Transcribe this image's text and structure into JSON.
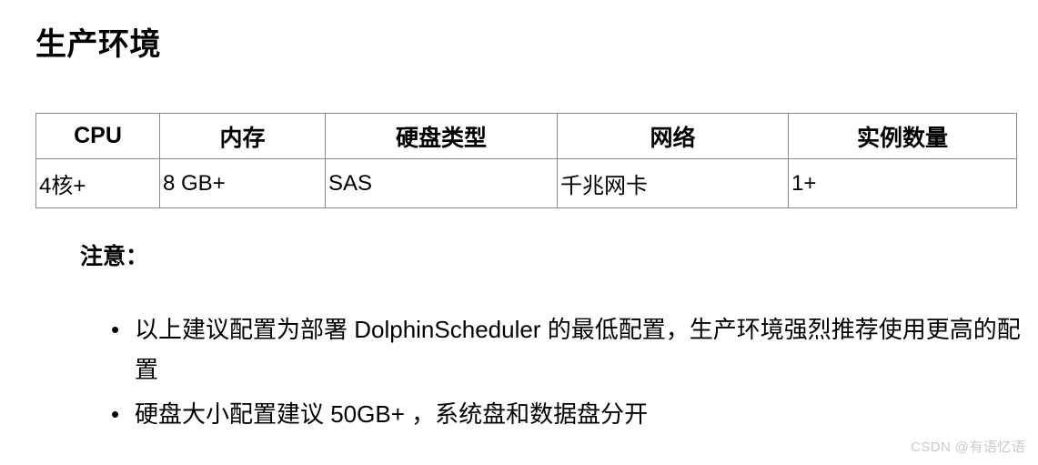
{
  "document": {
    "title": "生产环境"
  },
  "table": {
    "headers": [
      "CPU",
      "内存",
      "硬盘类型",
      "网络",
      "实例数量"
    ],
    "rows": [
      [
        "4核+",
        "8 GB+",
        "SAS",
        "千兆网卡",
        "1+"
      ]
    ]
  },
  "notes": {
    "heading": "注意：",
    "items": [
      "以上建议配置为部署 DolphinScheduler 的最低配置，生产环境强烈推荐使用更高的配置",
      "硬盘大小配置建议 50GB+ ，系统盘和数据盘分开"
    ],
    "bullet_glyph": "•"
  },
  "watermark": {
    "text": "CSDN @有语忆语",
    "color": "#c9cacc"
  }
}
